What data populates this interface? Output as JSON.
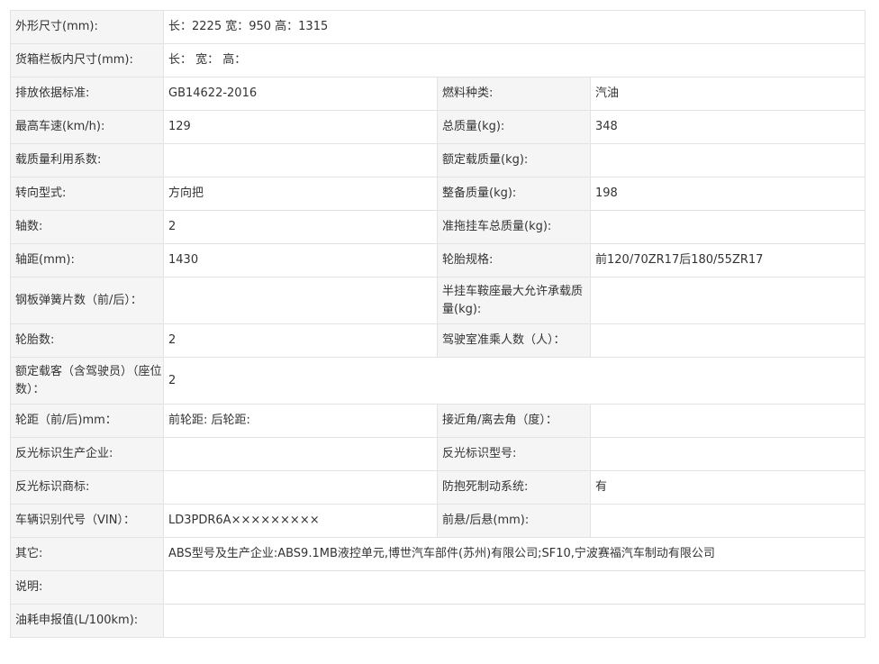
{
  "rows": [
    {
      "label": "外形尺寸(mm):",
      "value": "长：2225 宽：950 高：1315"
    },
    {
      "label": "货箱栏板内尺寸(mm):",
      "value": "长： 宽： 高："
    },
    {
      "label": "排放依据标准:",
      "value": "GB14622-2016",
      "label2": "燃料种类:",
      "value2": "汽油"
    },
    {
      "label": "最高车速(km/h):",
      "value": "129",
      "label2": "总质量(kg):",
      "value2": "348"
    },
    {
      "label": "载质量利用系数:",
      "value": "",
      "label2": "额定载质量(kg):",
      "value2": ""
    },
    {
      "label": "转向型式:",
      "value": "方向把",
      "label2": "整备质量(kg):",
      "value2": "198"
    },
    {
      "label": "轴数:",
      "value": "2",
      "label2": "准拖挂车总质量(kg):",
      "value2": ""
    },
    {
      "label": "轴距(mm):",
      "value": "1430",
      "label2": "轮胎规格:",
      "value2": "前120/70ZR17后180/55ZR17"
    },
    {
      "label": "钢板弹簧片数（前/后）：",
      "value": "",
      "label2": "半挂车鞍座最大允许承载质量(kg):",
      "value2": ""
    },
    {
      "label": "轮胎数:",
      "value": "2",
      "label2": "驾驶室准乘人数（人）：",
      "value2": ""
    },
    {
      "label": "额定载客（含驾驶员）（座位数）：",
      "value": "2"
    },
    {
      "label": "轮距（前/后)mm：",
      "value": "前轮距: 后轮距:",
      "label2": "接近角/离去角（度）：",
      "value2": ""
    },
    {
      "label": "反光标识生产企业:",
      "value": "",
      "label2": "反光标识型号:",
      "value2": ""
    },
    {
      "label": "反光标识商标:",
      "value": "",
      "label2": "防抱死制动系统:",
      "value2": "有"
    },
    {
      "label": "车辆识别代号（VIN）：",
      "value": "LD3PDR6A×××××××××",
      "label2": "前悬/后悬(mm):",
      "value2": ""
    },
    {
      "label": "其它:",
      "value": "ABS型号及生产企业:ABS9.1MB液控单元,博世汽车部件(苏州)有限公司;SF10,宁波赛福汽车制动有限公司"
    },
    {
      "label": "说明:",
      "value": ""
    },
    {
      "label": "油耗申报值(L/100km):",
      "value": ""
    }
  ]
}
